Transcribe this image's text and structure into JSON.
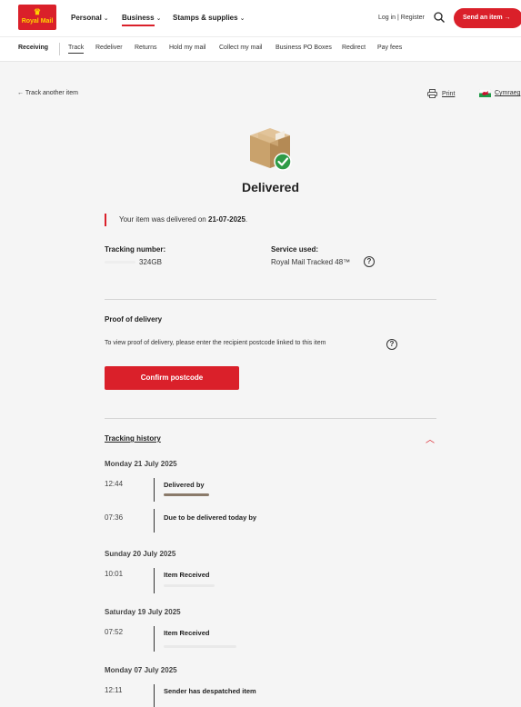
{
  "header": {
    "logo_text": "Royal Mail",
    "nav": [
      {
        "label": "Personal"
      },
      {
        "label": "Business"
      },
      {
        "label": "Stamps & supplies"
      }
    ],
    "login": "Log in",
    "register": "Register",
    "send_button": "Send an item",
    "accent_color": "#da202a"
  },
  "subnav": {
    "section": "Receiving",
    "items": [
      "Track",
      "Redeliver",
      "Returns",
      "Hold my mail",
      "Collect my mail",
      "Business PO Boxes",
      "Redirect",
      "Pay fees"
    ]
  },
  "actions": {
    "back": "Track another item",
    "print": "Print",
    "language": "Cymraeg"
  },
  "status": {
    "title": "Delivered",
    "message_prefix": "Your item was delivered on",
    "date": "21-07-2025",
    "message_suffix": "."
  },
  "details": {
    "tracking_label": "Tracking number:",
    "tracking_value": "324GB",
    "service_label": "Service used:",
    "service_value": "Royal Mail Tracked 48™"
  },
  "proof": {
    "title": "Proof of delivery",
    "text": "To view proof of delivery, please enter the recipient postcode linked to this item",
    "button": "Confirm postcode"
  },
  "history": {
    "title": "Tracking history",
    "days": [
      {
        "date": "Monday 21 July 2025",
        "events": [
          {
            "time": "12:44",
            "label": "Delivered by"
          },
          {
            "time": "07:36",
            "label": "Due to be delivered today by"
          }
        ]
      },
      {
        "date": "Sunday 20 July 2025",
        "events": [
          {
            "time": "10:01",
            "label": "Item Received"
          }
        ]
      },
      {
        "date": "Saturday 19 July 2025",
        "events": [
          {
            "time": "07:52",
            "label": "Item Received"
          }
        ]
      },
      {
        "date": "Monday 07 July 2025",
        "events": [
          {
            "time": "12:11",
            "label": "Sender has despatched item"
          }
        ]
      }
    ]
  }
}
